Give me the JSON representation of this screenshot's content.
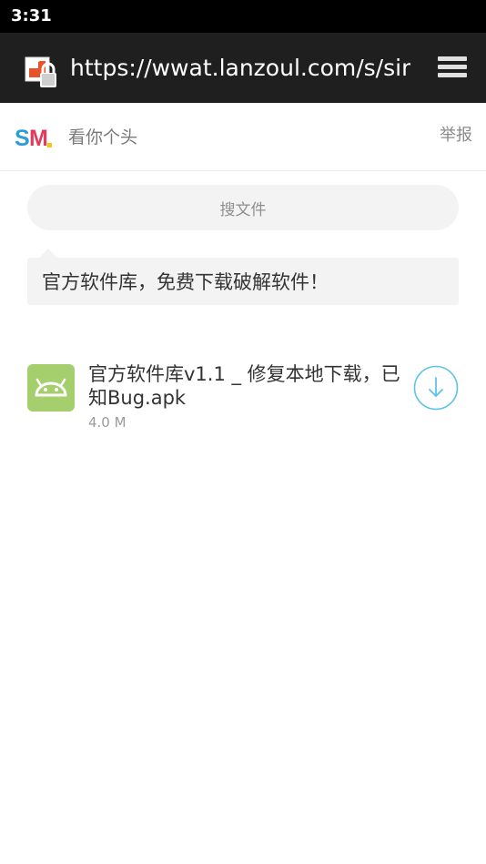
{
  "status_bar": {
    "time": "3:31"
  },
  "browser": {
    "url": "https://wwat.lanzoul.com/s/sim"
  },
  "header": {
    "logo_text": "SM",
    "site_title": "看你个头",
    "report_label": "举报"
  },
  "search": {
    "placeholder": "搜文件"
  },
  "notice": {
    "text": "官方软件库，免费下载破解软件！"
  },
  "files": [
    {
      "name": "官方软件库v1.1 _ 修复本地下载，已知Bug.apk",
      "size": "4.0 M",
      "icon": "android-icon"
    }
  ],
  "colors": {
    "accent": "#5bc3e8",
    "apk_icon_bg": "#a4cf6c",
    "url_bar_bg": "#1f1f1f"
  }
}
